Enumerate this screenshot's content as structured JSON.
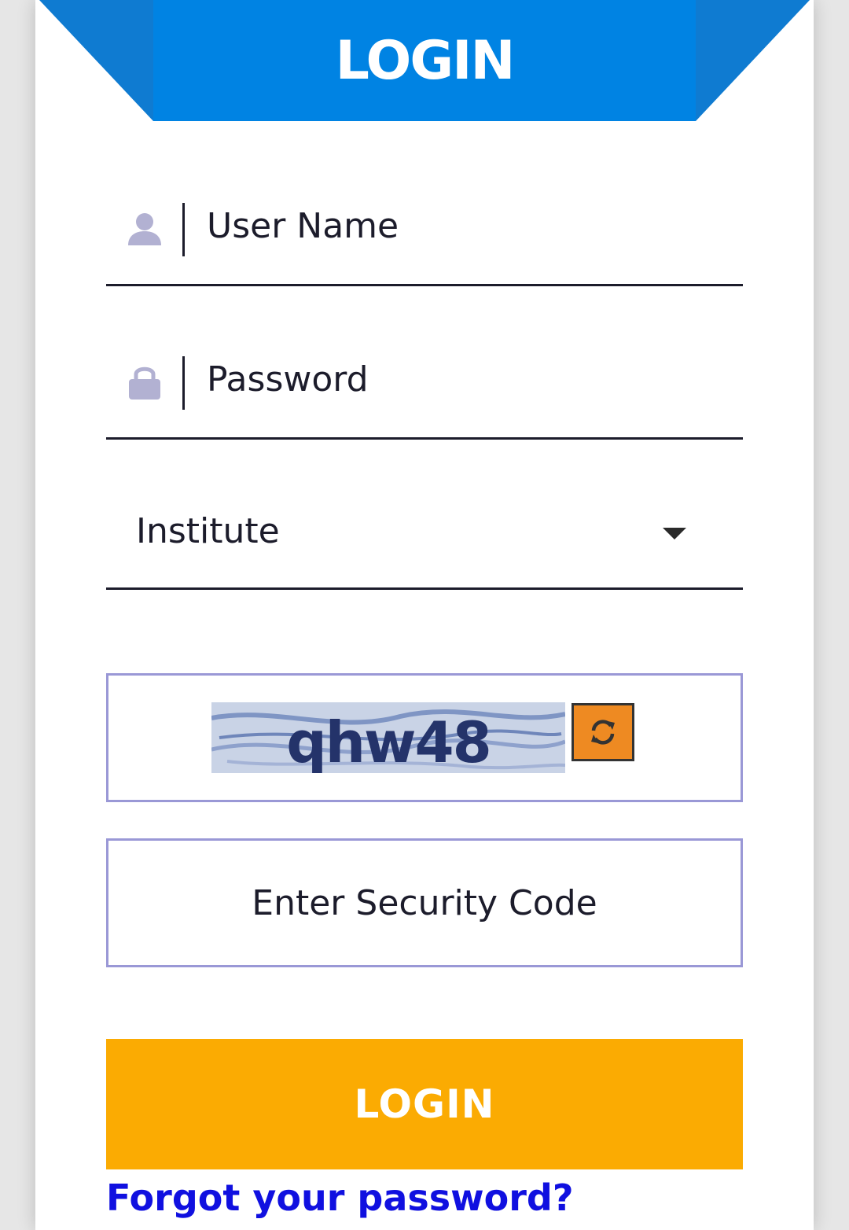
{
  "header": {
    "title": "LOGIN"
  },
  "form": {
    "username_placeholder": "User Name",
    "password_placeholder": "Password",
    "institute_select": "Institute",
    "captcha_text": "qhw48",
    "security_code_placeholder": "Enter Security Code",
    "login_button": "LOGIN",
    "forgot_link": "Forgot your password?"
  },
  "colors": {
    "ribbon_blue": "#0083e3",
    "ribbon_dark_blue": "#0f7bd1",
    "login_button": "#fbab02",
    "refresh_button": "#ee8a22",
    "input_border": "#9a98d6",
    "link_blue": "#1010e0"
  },
  "icons": {
    "username": "user-icon",
    "password": "lock-icon",
    "select": "caret-down-icon",
    "refresh": "refresh-icon"
  }
}
